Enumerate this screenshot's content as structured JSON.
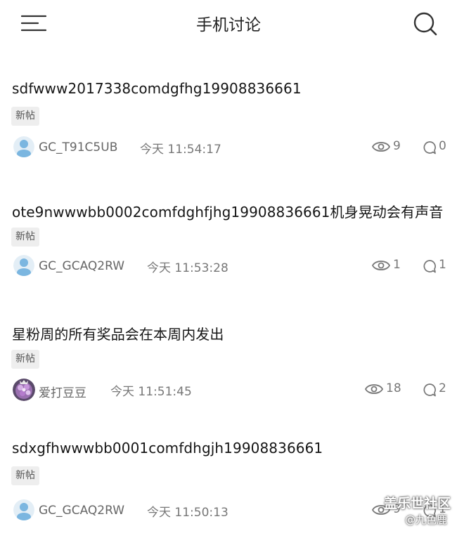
{
  "header": {
    "title": "手机讨论",
    "menu_icon": "menu-icon",
    "search_icon": "search-icon"
  },
  "posts": [
    {
      "title": "sdfwww2017338comdgfhg19908836661",
      "badge": "新帖",
      "author": "GC_T91C5UB",
      "time": "今天 11:54:17",
      "views": "9",
      "comments": "0",
      "avatar": "default-avatar"
    },
    {
      "title": "ote9nwwwbb0002comfdghfjhg19908836661机身晃动会有声音",
      "badge": "新帖",
      "author": "GC_GCAQ2RW",
      "time": "今天 11:53:28",
      "views": "1",
      "comments": "1",
      "avatar": "default-avatar"
    },
    {
      "title": "星粉周的所有奖品会在本周内发出",
      "badge": "新帖",
      "author": "爱打豆豆",
      "time": "今天 11:51:45",
      "views": "18",
      "comments": "2",
      "avatar": "flower-photo-avatar"
    },
    {
      "title": "sdxgfhwwwbb0001comfdhgjh19908836661",
      "badge": "新帖",
      "author": "GC_GCAQ2RW",
      "time": "今天 11:50:13",
      "views": "9",
      "comments": "1",
      "avatar": "default-avatar"
    }
  ],
  "watermark": {
    "line1": "盖乐世社区",
    "line2": "@九色鹿"
  },
  "colors": {
    "text": "#1a1a1a",
    "meta": "#777777",
    "badge_bg": "#eeeeee",
    "avatar_bg": "#e3eef6",
    "avatar_fg": "#7bb6e0"
  }
}
